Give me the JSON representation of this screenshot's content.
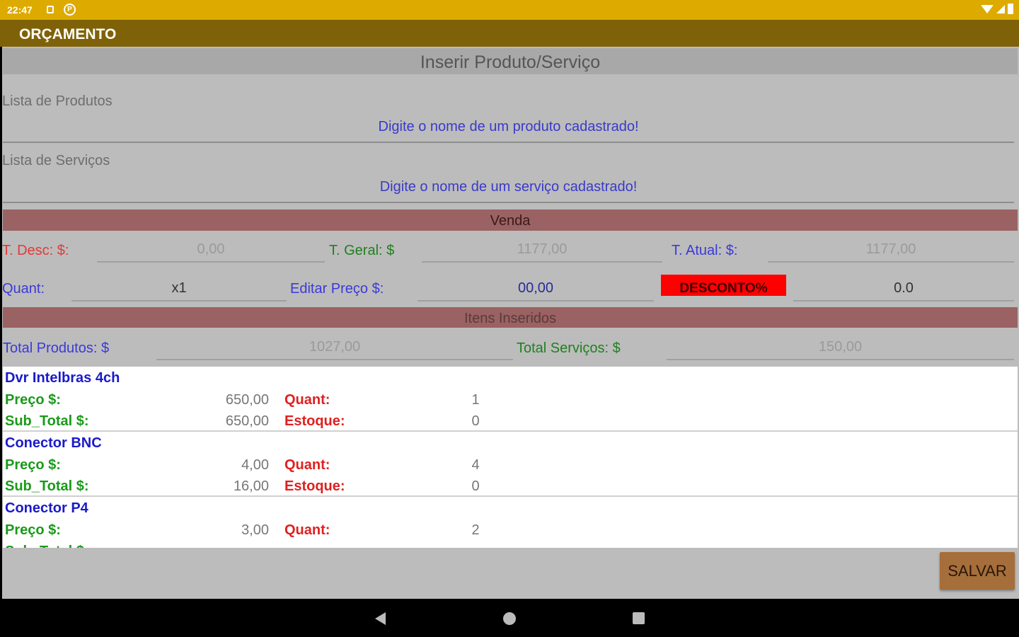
{
  "status_bar": {
    "time": "22:47",
    "icons": [
      "sim-icon",
      "app-notification-icon",
      "wifi-icon",
      "cell-signal-icon",
      "battery-icon"
    ],
    "notif_letter": "P"
  },
  "app_bar": {
    "title": "ORÇAMENTO"
  },
  "insert_section": {
    "title": "Inserir Produto/Serviço",
    "products_label": "Lista de Produtos",
    "products_placeholder": "Digite o nome de um produto cadastrado!",
    "services_label": "Lista de Serviços",
    "services_placeholder": "Digite o nome de um serviço cadastrado!"
  },
  "venda": {
    "title": "Venda",
    "t_desc_label": "T. Desc: $:",
    "t_desc_value": "0,00",
    "t_geral_label": "T. Geral: $",
    "t_geral_value": "1177,00",
    "t_atual_label": "T. Atual: $:",
    "t_atual_value": "1177,00",
    "quant_label": "Quant:",
    "quant_value": "x1",
    "editar_preco_label": "Editar Preço $:",
    "editar_preco_value": "00,00",
    "desconto_button": "DESCONTO%",
    "desconto_value": "0.0"
  },
  "itens": {
    "title": "Itens Inseridos",
    "total_produtos_label": "Total Produtos: $",
    "total_produtos_value": "1027,00",
    "total_servicos_label": "Total Serviços: $",
    "total_servicos_value": "150,00",
    "labels": {
      "preco": "Preço $:",
      "subtotal": "Sub_Total $:",
      "quant": "Quant:",
      "estoque": "Estoque:"
    },
    "list": [
      {
        "name": "Dvr Intelbras 4ch",
        "preco": "650,00",
        "subtotal": "650,00",
        "quant": "1",
        "estoque": "0"
      },
      {
        "name": "Conector BNC",
        "preco": "4,00",
        "subtotal": "16,00",
        "quant": "4",
        "estoque": "0"
      },
      {
        "name": "Conector P4",
        "preco": "3,00",
        "subtotal": "",
        "quant": "2",
        "estoque": ""
      }
    ]
  },
  "save_button": "SALVAR",
  "colors": {
    "status_bar": "#ddaa00",
    "app_bar": "#7f6208",
    "section_header": "#9a6262",
    "desconto_button": "#ff0000",
    "save_button": "#a66e3a"
  }
}
